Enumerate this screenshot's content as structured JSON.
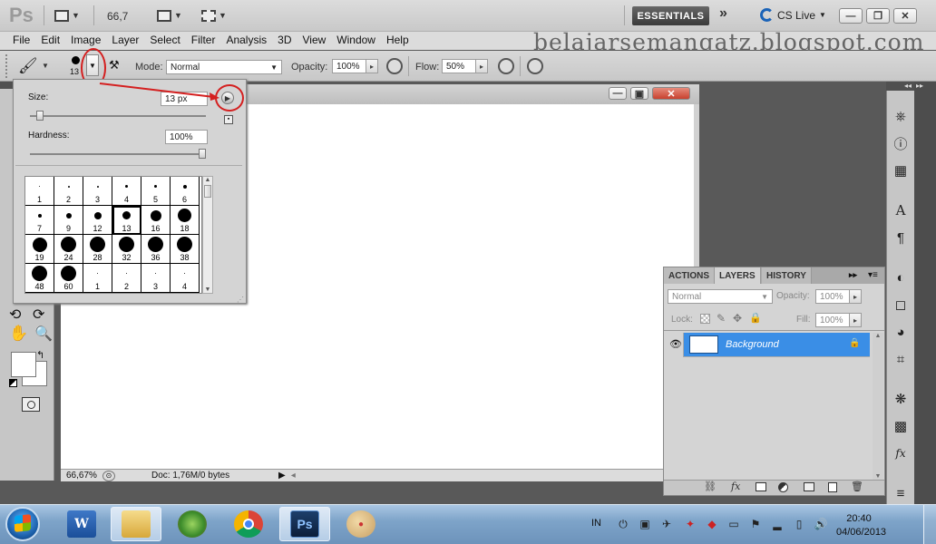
{
  "app": {
    "logo": "Ps",
    "zoom": "66,7",
    "essentials": "ESSENTIALS",
    "cs_live": "CS Live",
    "chevrons": "»"
  },
  "menu": [
    "File",
    "Edit",
    "Image",
    "Layer",
    "Select",
    "Filter",
    "Analysis",
    "3D",
    "View",
    "Window",
    "Help"
  ],
  "watermark": "belajarsemangatz.blogspot.com",
  "options": {
    "brush_size": "13",
    "mode_label": "Mode:",
    "mode_value": "Normal",
    "opacity_label": "Opacity:",
    "opacity_value": "100%",
    "flow_label": "Flow:",
    "flow_value": "50%"
  },
  "picker": {
    "size_label": "Size:",
    "size_value": "13 px",
    "size_level_percent": 4,
    "hardness_label": "Hardness:",
    "hardness_value": "100%",
    "hardness_level_percent": 100,
    "presets": [
      {
        "n": "1",
        "d": 1
      },
      {
        "n": "2",
        "d": 2
      },
      {
        "n": "3",
        "d": 2
      },
      {
        "n": "4",
        "d": 3
      },
      {
        "n": "5",
        "d": 3
      },
      {
        "n": "6",
        "d": 4
      },
      {
        "n": "7",
        "d": 4
      },
      {
        "n": "9",
        "d": 6
      },
      {
        "n": "12",
        "d": 8
      },
      {
        "n": "13",
        "d": 9
      },
      {
        "n": "16",
        "d": 12
      },
      {
        "n": "18",
        "d": 15
      },
      {
        "n": "19",
        "d": 16
      },
      {
        "n": "24",
        "d": 17
      },
      {
        "n": "28",
        "d": 17
      },
      {
        "n": "32",
        "d": 17
      },
      {
        "n": "36",
        "d": 17
      },
      {
        "n": "38",
        "d": 17
      },
      {
        "n": "48",
        "d": 17
      },
      {
        "n": "60",
        "d": 17
      },
      {
        "n": "1",
        "d": 1
      },
      {
        "n": "2",
        "d": 1
      },
      {
        "n": "3",
        "d": 1
      },
      {
        "n": "4",
        "d": 1
      }
    ],
    "selected_index": 9
  },
  "document": {
    "zoom": "66,67%",
    "doc_info": "Doc: 1,76M/0 bytes"
  },
  "layers_panel": {
    "tabs": [
      "ACTIONS",
      "LAYERS",
      "HISTORY"
    ],
    "active_tab": "LAYERS",
    "blend_mode": "Normal",
    "opacity_label": "Opacity:",
    "opacity_value": "100%",
    "lock_label": "Lock:",
    "fill_label": "Fill:",
    "fill_value": "100%",
    "layer_name": "Background"
  },
  "taskbar": {
    "language": "IN",
    "time": "20:40",
    "date": "04/06/2013",
    "ps_label": "Ps"
  },
  "colors": {
    "highlight_red": "#d42020",
    "layer_selected": "#3a8ee6",
    "essentials_bg": "#4a4a4a"
  }
}
